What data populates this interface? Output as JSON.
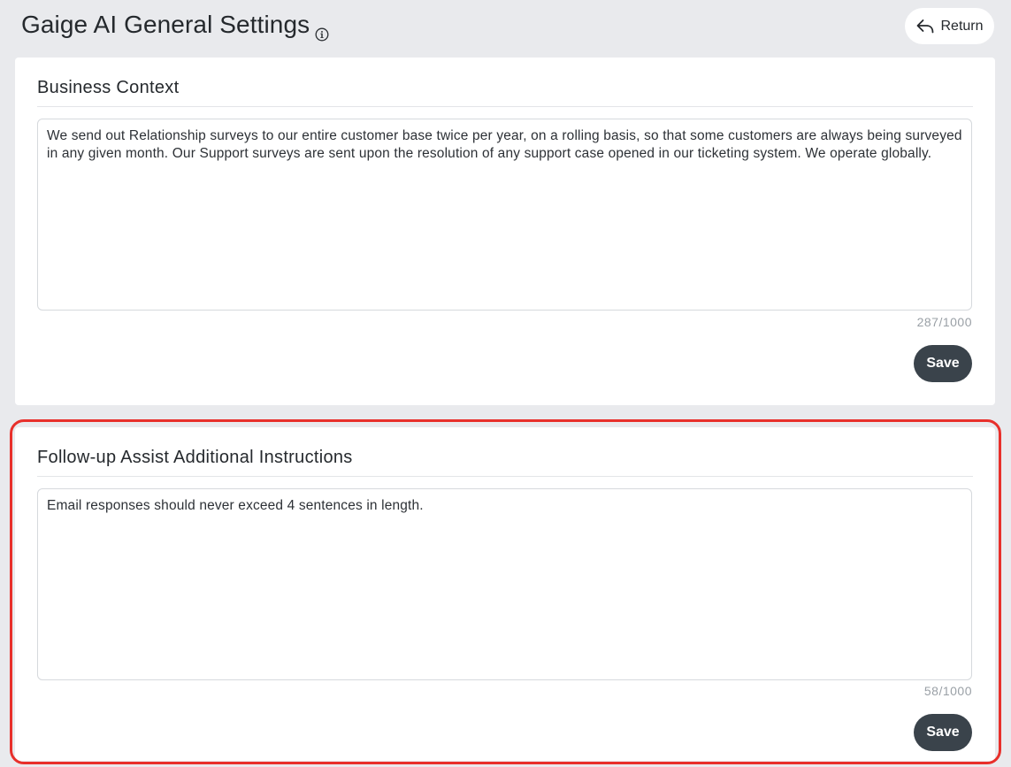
{
  "header": {
    "title": "Gaige AI General Settings",
    "info_icon": "info-circle-icon",
    "return_label": "Return",
    "return_icon": "reply-arrow-icon"
  },
  "business_context": {
    "title": "Business Context",
    "value": "We send out Relationship surveys to our entire customer base twice per year, on a rolling basis, so that some customers are always being surveyed in any given month. Our Support surveys are sent upon the resolution of any support case opened in our ticketing system. We operate globally.",
    "char_count": "287/1000",
    "save_label": "Save"
  },
  "followup_instructions": {
    "title": "Follow-up Assist Additional Instructions",
    "value": "Email responses should never exceed 4 sentences in length.",
    "char_count": "58/1000",
    "save_label": "Save",
    "highlighted": true,
    "highlight_color": "#e8302b"
  },
  "colors": {
    "background": "#e9eaed",
    "card": "#ffffff",
    "save_button": "#3a434b",
    "muted_text": "#9aa0a6"
  }
}
